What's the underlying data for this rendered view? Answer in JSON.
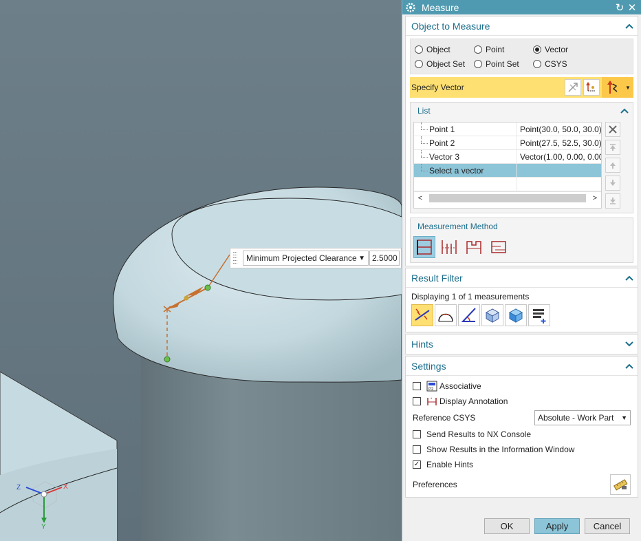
{
  "viewport": {
    "label": {
      "mode": "Minimum Projected Clearance",
      "value": "2.5000"
    },
    "triad": {
      "x_label": "X",
      "y_label": "Y",
      "z_label": "Z"
    }
  },
  "dialog": {
    "title": "Measure",
    "object_section": {
      "title": "Object to Measure",
      "radios": [
        {
          "label": "Object",
          "selected": false
        },
        {
          "label": "Point",
          "selected": false
        },
        {
          "label": "Vector",
          "selected": true
        },
        {
          "label": "Object Set",
          "selected": false
        },
        {
          "label": "Point Set",
          "selected": false
        },
        {
          "label": "CSYS",
          "selected": false
        }
      ],
      "specify_label": "Specify Vector",
      "list": {
        "title": "List",
        "rows": [
          {
            "name": "Point 1",
            "value": "Point(30.0, 50.0, 30.0)"
          },
          {
            "name": "Point 2",
            "value": "Point(27.5, 52.5, 30.0)"
          },
          {
            "name": "Vector 3",
            "value": "Vector(1.00, 0.00, 0.00)"
          },
          {
            "name": "Select a vector",
            "value": ""
          }
        ]
      },
      "measurement_method": {
        "title": "Measurement Method"
      }
    },
    "result_filter": {
      "title": "Result Filter",
      "text": "Displaying 1 of 1 measurements"
    },
    "hints": {
      "title": "Hints"
    },
    "settings": {
      "title": "Settings",
      "associative": {
        "label": "Associative",
        "checked": false
      },
      "display_annotation": {
        "label": "Display Annotation",
        "checked": false
      },
      "reference_csys_label": "Reference CSYS",
      "reference_csys_value": "Absolute - Work Part",
      "send_results": {
        "label": "Send Results to NX Console",
        "checked": false
      },
      "show_results": {
        "label": "Show Results in the Information Window",
        "checked": false
      },
      "enable_hints": {
        "label": "Enable Hints",
        "checked": true
      },
      "preferences_label": "Preferences"
    },
    "buttons": {
      "ok": "OK",
      "apply": "Apply",
      "cancel": "Cancel"
    }
  },
  "colors": {
    "title_bar": "#4f9ab0",
    "section_header_text": "#1c6e8c",
    "highlight_yellow": "#fddf72",
    "selection_blue": "#8cc4d8",
    "measure_line": "#c7702e"
  }
}
